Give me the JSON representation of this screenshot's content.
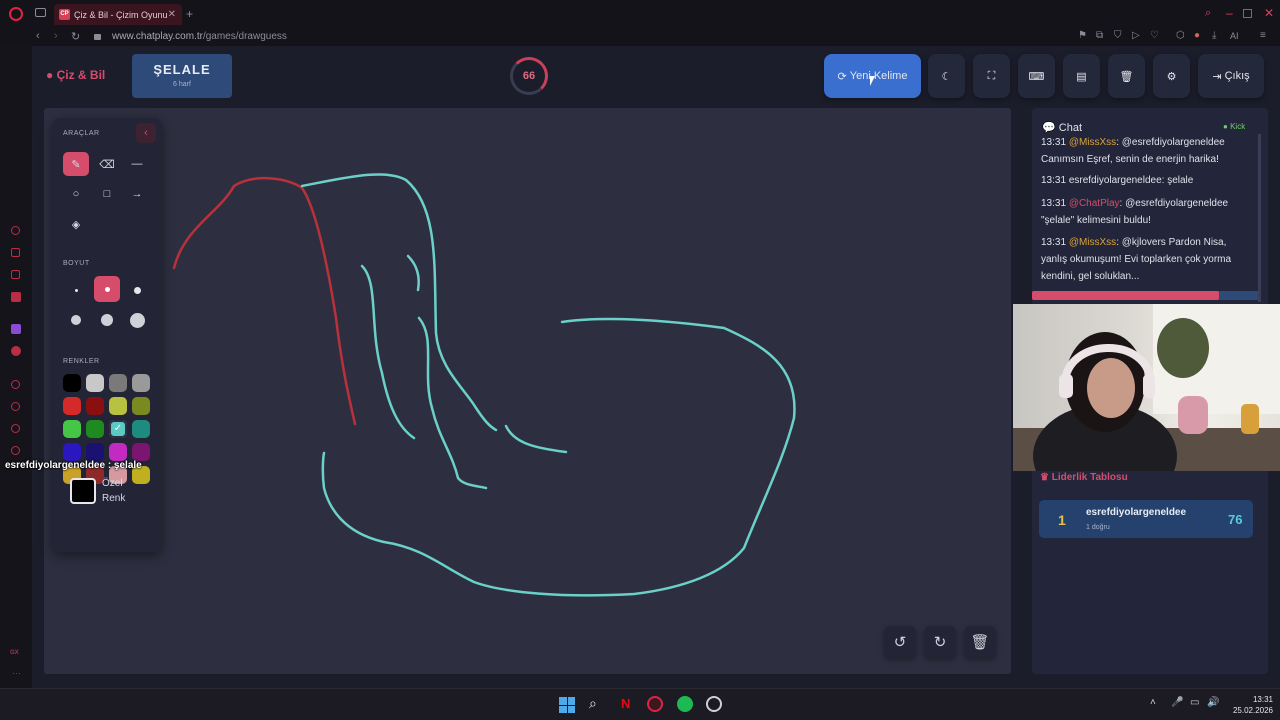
{
  "browser": {
    "tab_title": "Çiz & Bil - Çizim Oyunu",
    "tab_favicon": "CP",
    "url_domain": "www.chatplay.com.tr",
    "url_path": "/games/drawguess",
    "ai_label": "AI"
  },
  "header": {
    "brand": "Çiz & Bil",
    "word": "ŞELALE",
    "word_hint": "6 harf",
    "timer": "66",
    "new_word_label": "Yeni Kelime",
    "exit_label": "Çıkış"
  },
  "tools": {
    "title": "ARAÇLAR",
    "size_title": "BOYUT",
    "colors_title": "RENKLER",
    "custom_color": "Özel",
    "custom_color2": "Renk",
    "palette": [
      "#000000",
      "#c8c8c8",
      "#7a7a7a",
      "#9a9a9a",
      "#d42a2a",
      "#8a1010",
      "#b9c240",
      "#7b8a20",
      "#46c646",
      "#1f8a1f",
      "#5cc9c4",
      "#1f8a7f",
      "#2a17c2",
      "#1a1170",
      "#c22ac2",
      "#7a1570",
      "#c9a128",
      "#8f2a2a",
      "#d49aa0",
      "#c0b020"
    ]
  },
  "overlay_caption": "esrefdiyolargeneldee : şelale",
  "chat": {
    "title": "Chat",
    "status": "Kick",
    "messages": [
      {
        "time": "13:31",
        "user": "@MissXss",
        "text": ": @esrefdiyolargeneldee Canımsın Eşref, senin de enerjin harika!"
      },
      {
        "time": "13:31",
        "user": "",
        "text": "esrefdiyolargeneldee: şelale"
      },
      {
        "time": "13:31",
        "user": "@ChatPlay",
        "text": ": @esrefdiyolargeneldee \"şelale\" kelimesini buldu!"
      },
      {
        "time": "13:31",
        "user": "@MissXss",
        "text": ": @kjlovers Pardon Nisa, yanlış okumuşum! Evi toplarken çok yorma kendini, gel soluklan..."
      }
    ]
  },
  "leaderboard": {
    "title": "Liderlik Tablosu",
    "entries": [
      {
        "rank": "1",
        "name": "esrefdiyolargeneldee",
        "detail": "1 doğru",
        "score": "76"
      }
    ]
  },
  "taskbar": {
    "time": "13:31",
    "date": "25.02.2026"
  },
  "colors": {
    "accent": "#d64d6c",
    "selected_word_bg": "#2e4a78",
    "new_word_bg": "#3a6fd0",
    "stroke_red": "#b8313b",
    "stroke_teal": "#6bd1c8"
  }
}
